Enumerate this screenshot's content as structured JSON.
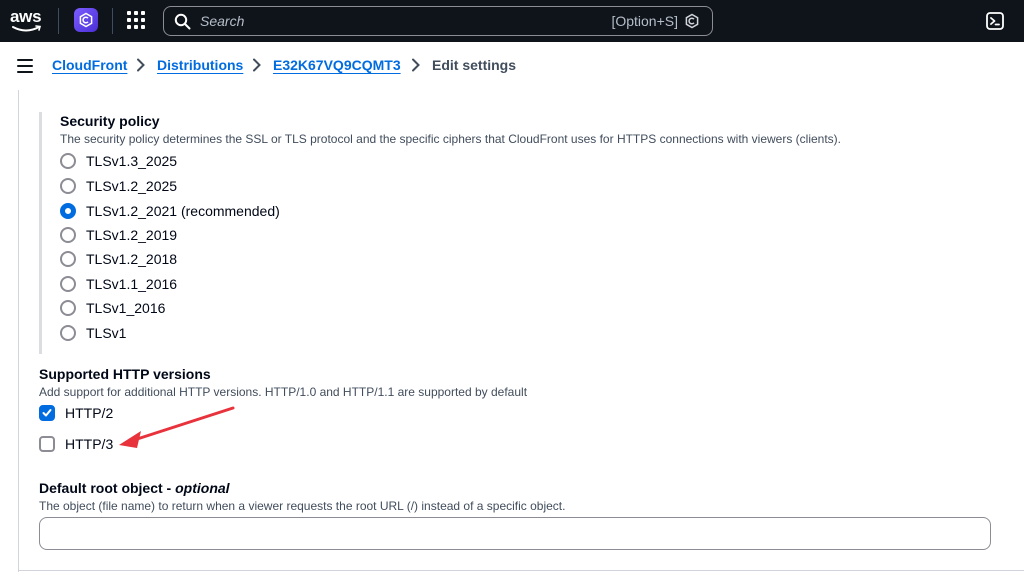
{
  "topnav": {
    "logo_text": "aws",
    "search_placeholder": "Search",
    "search_shortcut": "[Option+S]"
  },
  "breadcrumb": {
    "items": [
      "CloudFront",
      "Distributions",
      "E32K67VQ9CQMT3"
    ],
    "current": "Edit settings"
  },
  "security_policy": {
    "label": "Security policy",
    "description": "The security policy determines the SSL or TLS protocol and the specific ciphers that CloudFront uses for HTTPS connections with viewers (clients).",
    "options": [
      "TLSv1.3_2025",
      "TLSv1.2_2025",
      "TLSv1.2_2021 (recommended)",
      "TLSv1.2_2019",
      "TLSv1.2_2018",
      "TLSv1.1_2016",
      "TLSv1_2016",
      "TLSv1"
    ],
    "selected": "TLSv1.2_2021 (recommended)"
  },
  "http_versions": {
    "label": "Supported HTTP versions",
    "description": "Add support for additional HTTP versions. HTTP/1.0 and HTTP/1.1 are supported by default",
    "options": [
      {
        "label": "HTTP/2",
        "checked": true
      },
      {
        "label": "HTTP/3",
        "checked": false
      }
    ]
  },
  "default_root_object": {
    "label": "Default root object - ",
    "label_optional": "optional",
    "description": "The object (file name) to return when a viewer requests the root URL (/) instead of a specific object.",
    "value": ""
  },
  "colors": {
    "nav_bg": "#0f141a",
    "link": "#006ce0",
    "annotation_arrow": "#e8323c"
  }
}
